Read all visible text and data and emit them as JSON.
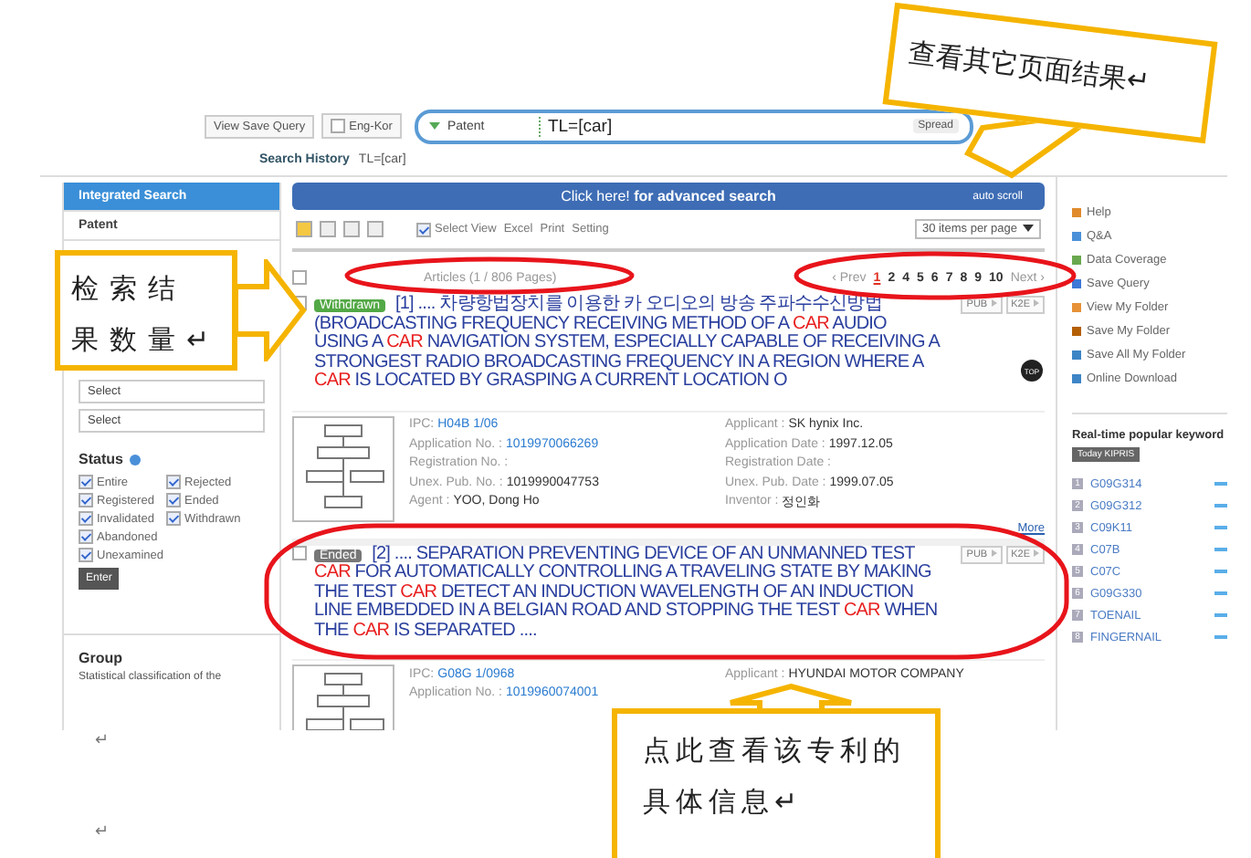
{
  "search_bar": {
    "save_query": "View Save Query",
    "eng_kor": {
      "label": "Eng-Kor",
      "checked": false
    },
    "scope": "Patent",
    "query": "TL=[car]",
    "spread": "Spread",
    "history_label": "Search History",
    "history_value": "TL=[car]"
  },
  "sidebar": {
    "menu": [
      {
        "label": "Integrated Search",
        "selected": true
      },
      {
        "label": "Patent",
        "selected": false
      }
    ],
    "selects": [
      "Select",
      "Select"
    ],
    "status_title": "Status",
    "statuses": [
      {
        "label": "Entire",
        "checked": true
      },
      {
        "label": "Rejected",
        "checked": true
      },
      {
        "label": "Registered",
        "checked": true
      },
      {
        "label": "Ended",
        "checked": true
      },
      {
        "label": "Invalidated",
        "checked": true
      },
      {
        "label": "Withdrawn",
        "checked": true
      },
      {
        "label": "Abandoned",
        "checked": true
      },
      {
        "label": "Unexamined",
        "checked": true
      }
    ],
    "enter": "Enter",
    "group_title": "Group",
    "group_text": "Statistical classification of the"
  },
  "banner": {
    "text": "Click here!",
    "link": "for advanced search",
    "auto_scroll": "auto scroll"
  },
  "toolbar": {
    "select_view": {
      "label": "Select View",
      "checked": true
    },
    "excel": "Excel",
    "print": "Print",
    "setting": "Setting",
    "per_page": "30 items per page"
  },
  "summary": "Articles (1 / 806 Pages)",
  "pagination": {
    "prev": "‹ Prev",
    "pages": [
      {
        "label": "1",
        "selected": true
      },
      {
        "label": "2",
        "selected": false
      },
      {
        "label": "4",
        "selected": false
      },
      {
        "label": "5",
        "selected": false
      },
      {
        "label": "6",
        "selected": false
      },
      {
        "label": "7",
        "selected": false
      },
      {
        "label": "8",
        "selected": false
      },
      {
        "label": "9",
        "selected": false
      },
      {
        "label": "10",
        "selected": false
      }
    ],
    "next": "Next ›"
  },
  "results": [
    {
      "status": "Withdrawn",
      "kind": "withdrawn",
      "title": [
        {
          "text": "[1] .... 차량항법장치를 이용한 카 오디오의 방송 주파수수신방법 (BROADCASTING FREQUENCY RECEIVING METHOD OF A ",
          "hl": false
        },
        {
          "text": "CAR",
          "hl": true
        },
        {
          "text": " AUDIO USING A ",
          "hl": false
        },
        {
          "text": "CAR",
          "hl": true
        },
        {
          "text": " NAVIGATION SYSTEM, ESPECIALLY CAPABLE OF RECEIVING A STRONGEST RADIO BROADCASTING FREQUENCY IN A REGION WHERE A ",
          "hl": false
        },
        {
          "text": "CAR",
          "hl": true
        },
        {
          "text": " IS LOCATED BY GRASPING A CURRENT LOCATION O",
          "hl": false
        }
      ],
      "buttons": [
        "PUB",
        "K2E"
      ],
      "left": [
        {
          "label": "IPC:",
          "value": "H04B 1/06",
          "link": true
        },
        {
          "label": "Application No. :",
          "value": "1019970066269",
          "link": true
        },
        {
          "label": "Registration No. :"
        },
        {
          "label": "Unex. Pub. No. :",
          "value": "1019990047753",
          "link": false
        },
        {
          "label": "Agent :",
          "value": "YOO, Dong Ho",
          "link": false
        }
      ],
      "right": [
        {
          "label": "Applicant :",
          "value": "SK hynix Inc.",
          "link": false
        },
        {
          "label": "Application Date :",
          "value": "1997.12.05",
          "link": false
        },
        {
          "label": "Registration Date :"
        },
        {
          "label": "Unex. Pub. Date :",
          "value": "1999.07.05",
          "link": false
        },
        {
          "label": "Inventor :",
          "value": "정인화",
          "link": false
        }
      ],
      "more": "More"
    },
    {
      "status": "Ended",
      "kind": "ended",
      "title": [
        {
          "text": "[2] .... SEPARATION PREVENTING DEVICE OF AN UNMANNED TEST ",
          "hl": false
        },
        {
          "text": "CAR",
          "hl": true
        },
        {
          "text": " FOR AUTOMATICALLY CONTROLLING A TRAVELING STATE BY MAKING THE TEST ",
          "hl": false
        },
        {
          "text": "CAR",
          "hl": true
        },
        {
          "text": " DETECT AN INDUCTION WAVELENGTH OF AN INDUCTION LINE EMBEDDED IN A BELGIAN ROAD AND STOPPING THE TEST ",
          "hl": false
        },
        {
          "text": "CAR",
          "hl": true
        },
        {
          "text": " WHEN THE ",
          "hl": false
        },
        {
          "text": "CAR",
          "hl": true
        },
        {
          "text": " IS SEPARATED ....",
          "hl": false
        }
      ],
      "buttons": [
        "PUB",
        "K2E"
      ],
      "left": [
        {
          "label": "IPC:",
          "value": "G08G 1/0968",
          "link": true
        },
        {
          "label": "Application No. :",
          "value": "1019960074001",
          "link": true
        }
      ],
      "right": [
        {
          "label": "Applicant :",
          "value": "HYUNDAI MOTOR COMPANY",
          "link": false
        }
      ]
    }
  ],
  "right_panel": {
    "links": [
      "Help",
      "Q&A",
      "Data Coverage",
      "Save Query",
      "View My Folder",
      "Save My Folder",
      "Save All My Folder",
      "Online Download"
    ],
    "top": "TOP",
    "popular_title": "Real-time popular keyword",
    "today_tab": "Today KIPRIS",
    "keywords": [
      {
        "rank": "1",
        "text": "G09G314"
      },
      {
        "rank": "2",
        "text": "G09G312"
      },
      {
        "rank": "3",
        "text": "C09K11"
      },
      {
        "rank": "4",
        "text": "C07B"
      },
      {
        "rank": "5",
        "text": "C07C"
      },
      {
        "rank": "6",
        "text": "G09G330"
      },
      {
        "rank": "7",
        "text": "TOENAIL"
      },
      {
        "rank": "8",
        "text": "FINGERNAIL"
      }
    ]
  },
  "annotations": [
    "检索结果数量↵",
    "查看其它页面结果↵",
    "点此查看该专利的具体信息↵"
  ],
  "doc_marks": [
    "↵",
    "↵"
  ]
}
